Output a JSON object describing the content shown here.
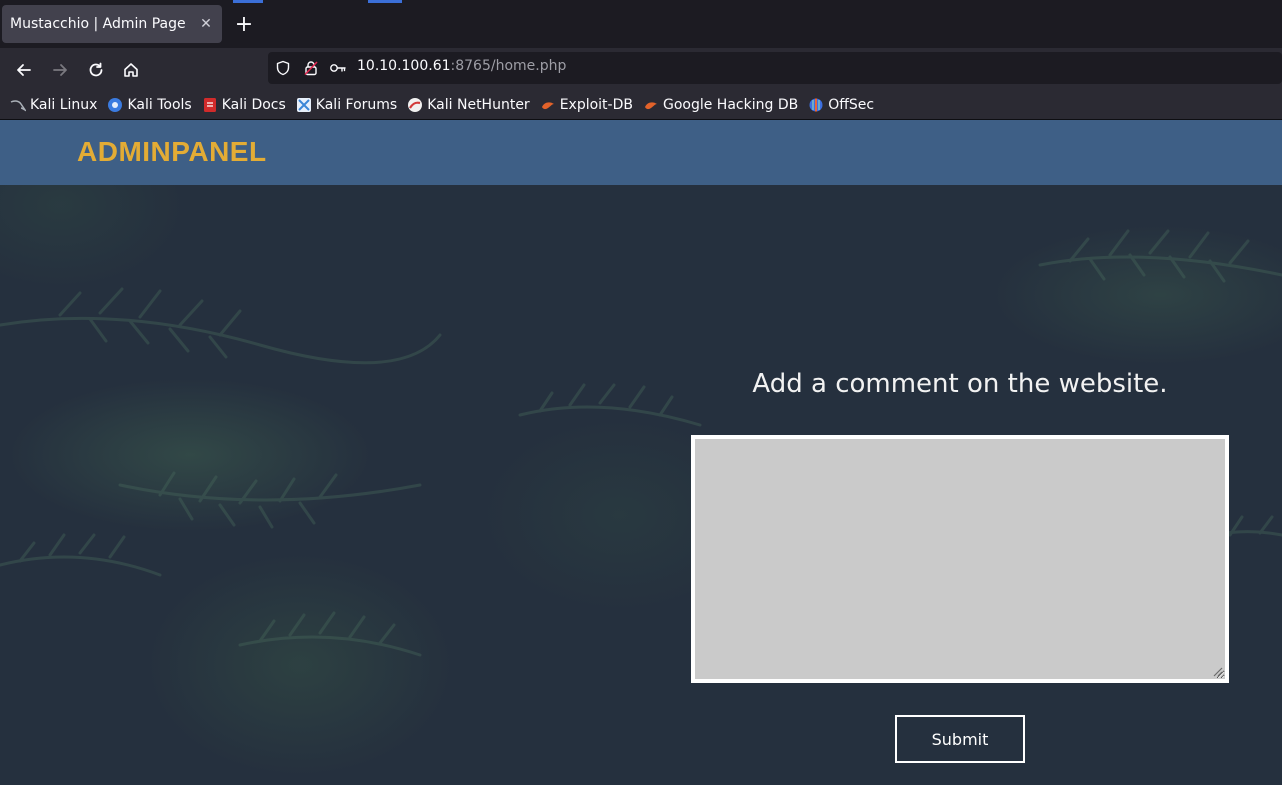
{
  "browser": {
    "tab": {
      "title": "Mustacchio | Admin Page",
      "close_glyph": "✕"
    },
    "new_tab_glyph": "+",
    "url": {
      "host": "10.10.100.61",
      "rest": ":8765/home.php"
    },
    "bookmarks": [
      {
        "label": "Kali Linux",
        "icon": "kali-dragon-icon",
        "color": "#9aa0a8"
      },
      {
        "label": "Kali Tools",
        "icon": "kali-tools-icon",
        "color": "#3b7be0"
      },
      {
        "label": "Kali Docs",
        "icon": "kali-docs-icon",
        "color": "#d12b2b"
      },
      {
        "label": "Kali Forums",
        "icon": "kali-forums-icon",
        "color": "#3a86d8"
      },
      {
        "label": "Kali NetHunter",
        "icon": "kali-nethunter-icon",
        "color": "#d23a3a"
      },
      {
        "label": "Exploit-DB",
        "icon": "exploit-db-icon",
        "color": "#e2622a"
      },
      {
        "label": "Google Hacking DB",
        "icon": "google-hacking-db-icon",
        "color": "#e2622a"
      },
      {
        "label": "OffSec",
        "icon": "offsec-icon",
        "color": "#3d6fe0"
      }
    ]
  },
  "page": {
    "brand": "ADMINPANEL",
    "brand_color": "#e3ac35",
    "header_color": "#3e5f86",
    "comment": {
      "title": "Add a comment on the website.",
      "value": "",
      "submit_label": "Submit"
    }
  }
}
